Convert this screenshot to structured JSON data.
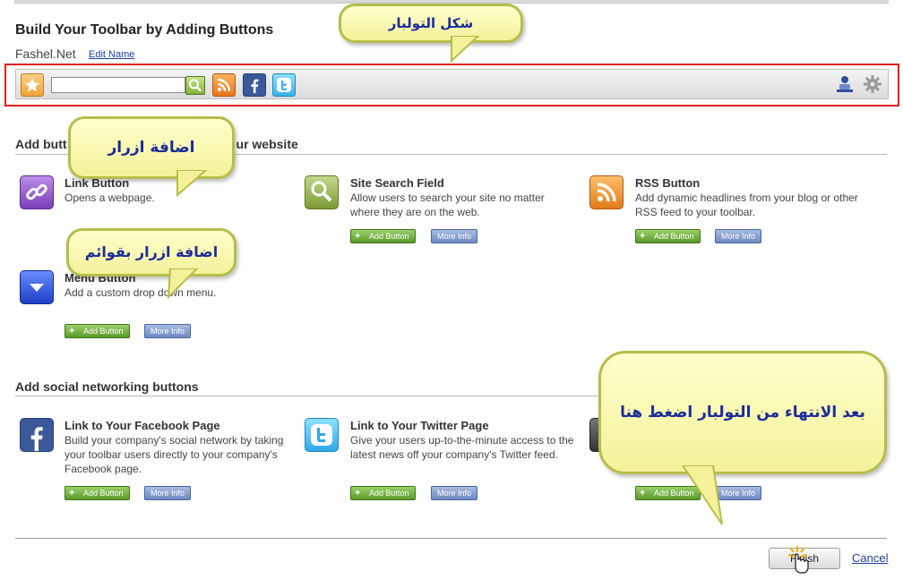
{
  "page": {
    "title": "Build Your Toolbar by Adding Buttons",
    "site_name": "Fashel.Net",
    "edit_name": "Edit Name"
  },
  "toolbar": {
    "search_value": "",
    "icons": [
      "star-icon",
      "search-icon",
      "rss-icon",
      "facebook-icon",
      "twitter-icon",
      "user-icon",
      "gear-icon"
    ]
  },
  "section_website": {
    "heading_start": "Add butt",
    "heading_end": "ur website"
  },
  "cards": [
    {
      "icon": "link-icon",
      "title": "Link Button",
      "desc": "Opens a webpage."
    },
    {
      "icon": "search-icon",
      "title": "Site Search Field",
      "desc": "Allow users to search your site no matter where they are on the web."
    },
    {
      "icon": "rss-icon",
      "title": "RSS Button",
      "desc": "Add dynamic headlines from your blog or other RSS feed to your toolbar."
    },
    {
      "icon": "dropdown-icon",
      "title": "Menu Button",
      "desc": "Add a custom drop down menu."
    }
  ],
  "section_social": {
    "heading": "Add social networking buttons"
  },
  "social_cards": [
    {
      "icon": "facebook-icon",
      "title": "Link to Your Facebook Page",
      "desc": "Build your company's social network by taking your toolbar users directly to your company's Facebook page."
    },
    {
      "icon": "twitter-icon",
      "title": "Link to Your Twitter Page",
      "desc": "Give your users up-to-the-minute access to the latest news off your company's Twitter feed."
    }
  ],
  "buttons": {
    "add": "Add Button",
    "more": "More Info",
    "add_partial": "Add Bu"
  },
  "footer": {
    "finish": "Finish",
    "cancel": "Cancel"
  },
  "callouts": {
    "toolbar_shape": "شكل التولبار",
    "add_buttons": "اضافة ازرار",
    "add_menu_buttons": "اضافة ازرار بقوائم",
    "finish_hint": "بعد الانتهاء من التولبار اضغط هنا"
  }
}
